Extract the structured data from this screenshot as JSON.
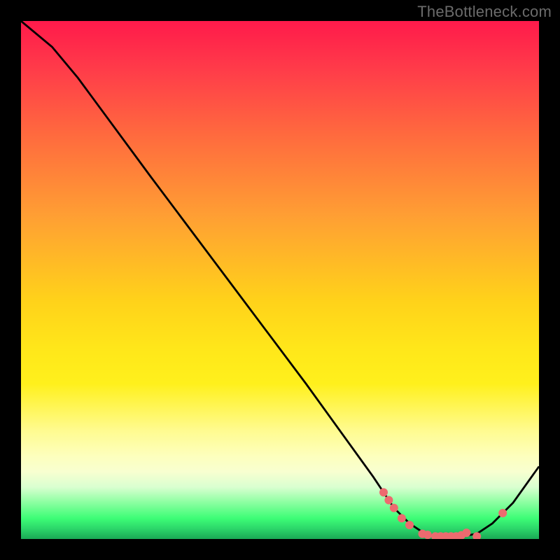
{
  "watermark": "TheBottleneck.com",
  "colors": {
    "background": "#000000",
    "curve_stroke": "#000000",
    "marker_fill": "#ed6a6f",
    "marker_stroke": "#b74a4f"
  },
  "chart_data": {
    "type": "line",
    "title": "",
    "xlabel": "",
    "ylabel": "",
    "xlim": [
      0,
      100
    ],
    "ylim": [
      0,
      100
    ],
    "curve_points": [
      {
        "x": 0,
        "y": 100
      },
      {
        "x": 6,
        "y": 95
      },
      {
        "x": 11,
        "y": 89
      },
      {
        "x": 25,
        "y": 70
      },
      {
        "x": 40,
        "y": 50
      },
      {
        "x": 55,
        "y": 30
      },
      {
        "x": 68,
        "y": 12
      },
      {
        "x": 72,
        "y": 6
      },
      {
        "x": 75,
        "y": 3
      },
      {
        "x": 78,
        "y": 1
      },
      {
        "x": 81,
        "y": 0.5
      },
      {
        "x": 85,
        "y": 0.5
      },
      {
        "x": 88,
        "y": 1
      },
      {
        "x": 91,
        "y": 3
      },
      {
        "x": 95,
        "y": 7
      },
      {
        "x": 100,
        "y": 14
      }
    ],
    "markers": [
      {
        "x": 70,
        "y": 9
      },
      {
        "x": 71,
        "y": 7.5
      },
      {
        "x": 72,
        "y": 6
      },
      {
        "x": 73.5,
        "y": 4
      },
      {
        "x": 75,
        "y": 2.7
      },
      {
        "x": 77.5,
        "y": 1
      },
      {
        "x": 78.5,
        "y": 0.8
      },
      {
        "x": 80,
        "y": 0.5
      },
      {
        "x": 81,
        "y": 0.5
      },
      {
        "x": 82,
        "y": 0.5
      },
      {
        "x": 83,
        "y": 0.5
      },
      {
        "x": 84,
        "y": 0.5
      },
      {
        "x": 85,
        "y": 0.7
      },
      {
        "x": 86,
        "y": 1.2
      },
      {
        "x": 88,
        "y": 0.5
      },
      {
        "x": 93,
        "y": 5
      }
    ]
  }
}
